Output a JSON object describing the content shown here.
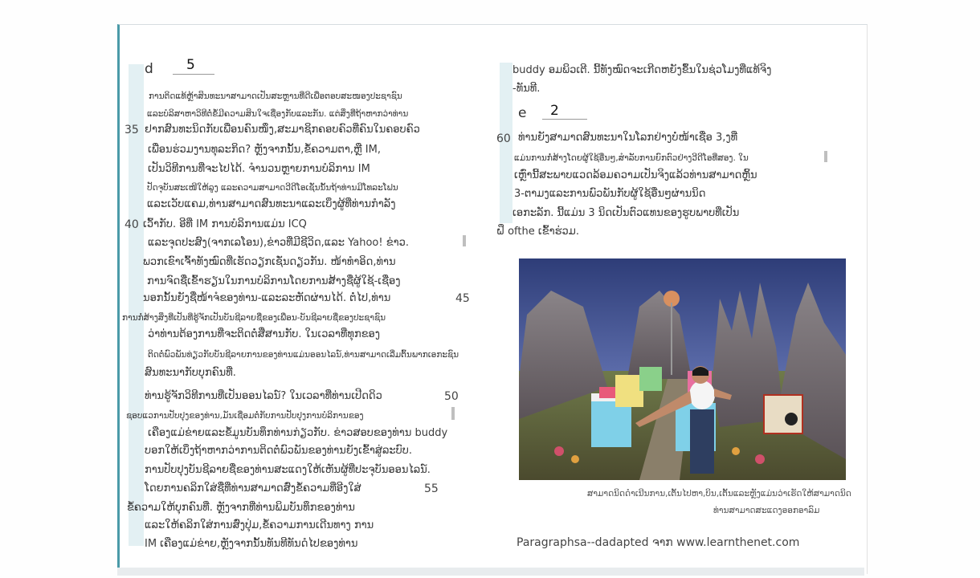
{
  "left": {
    "header_letter": "d",
    "header_number": "5",
    "line_numbers": [
      "35",
      "40",
      "45",
      "50",
      "55"
    ],
    "lines": [
      "ການຕິດແທ້ຫຼ້າສິນທະນາສາມາດເປັນສະຫຼານທີ່ດີເພື່ອຕອບສະໜອງປະຊາຊົນ",
      "ແລະບໍລິສາຫາວິທີຕໍ່ຂໍ້ມີຄວາມສິນໃຈເຊື່ອງກັບແລະກັນ. ແຕ່ສິ່ງທີ່ຖ້າຫາກວ່າທ່ານ",
      "ຢາກສົນທະນິດກັບເພື່ອນຄົນໜຶ່ງ,ສະມາຊິກຄອບຄົວທີ່ຄົນໃນຄອບຄົວ",
      "ເພື່ອນຮ່ວມງານທຸລະກິດ? ຫຼັງຈາກນັ້ນ,ຂໍ້ຄວາມຕາ,ຫຼື IM,",
      "ເປັນວິທີການທີ່ຈະໄປໄດ້. ຈຳນວນຫຼາຍການບໍລິການ IM",
      "ປັດຈຸບັນສະເໜີໃຫ້ລູງ ແລະຄວາມສາມາດວີດີໂອເຊັ່ນນັ້ນຖ້າທ່ານມີໂທລະໂຟນ",
      "ແລະເວັບແຄມ,ທ່ານສາມາດສົນທະນາແລະເບິ່ງຜູ້ທີ່ທ່ານກຳລັງ",
      "ເວົ້າກັບ. ອີທີ່ IM ການບໍລິການແມ່ນ ICQ",
      "ແລະຈຸດປະສົງ(ຈາກເລໂອນ),ຂ່າວທີ່ມີຊີວິດ,ແລະ Yahoo! ຂ່າວ.",
      "ພວກເຂົາເຈົ້າທັງໝົດທີ່ເຮັດວຽກເຊັ່ນດຽວກັນ. ໜ້າທຳອິດ,ທ່ານ",
      "ການຈົດຊື່ເຂົ້າຮຽນໃນການບໍລິການໂດຍການສ້າງຊື່ຜູ້ໃຊ້-ເຊື່ອງ",
      "ນອກນັ້ນຍັງຊື່ໜ້າຈໍຂອງທ່ານ-ແລະລະຫັດຜ່ານໄດ້. ຕໍ່ໄປ,ທ່ານ",
      "ການກໍ່ສ້າງສິ່ງທີ່ເປັນທີ່ຮູ້ຈັກເປັນບັນຊີລາຍຊື່ຂອງເພື່ອນ-ບັນຊີລາຍຊື່ຂອງປະຊາຊົນ",
      "ວ່າທ່ານຕ້ອງການທີ່ຈະຕິດຕໍ່ສື່ສານກັບ. ໃນເວລາທີ່ທຸກຂອງ",
      "ຕິດຕໍ່ພົວພັນທ່ຽວກັບບັນຊີລາຍການຂອງທ່ານແມ່ນອອນໄລນ໌,ທ່ານສາມາດເລີ່ມຕົ້ນພາກເອກະຊົນ",
      "ສົນທະນາກັບບຸກຄົນທີ່.",
      "ທ່ານຮູ້ຈັກວິທີການທີ່ເປັນອອນໄລນ໌? ໃນເວລາທີ່ທ່ານເປີດດິວ",
      "ຊອບແວການປັບປຸງຂອງທ່ານ,ມັນເຊື່ອມຕໍ່ກັບການປັບປຸງການບໍລິການຂອງ",
      "ເຄືອງແມ່ຂ່າຍແລະຂໍ້ມູນບັນທຶກທ່ານກ່ຽວກັບ. ຂ່າວສອບຂອງທ່ານ buddy",
      "ບອກໃຫ້ເບິ່ງຖ້າຫາກວ່າການຕິດຕໍ່ພົວພັນຂອງທ່ານຍັງເຂົ້າສູ່ລະບົບ.",
      "ການປັບປຸງບັນຊີລາຍຊື່ຂອງທ່ານສະແດງໃຫ້ເຫັນຜູ້ທີ່ປະຈຸບັນອອນໄລນ໌.",
      "ໂດຍການຄລິກໃສ່ຊື່ທີ່ທ່ານສາມາດສົ່ງຂໍ້ຄວາມທີ່ອີງໃສ່",
      "ຂໍ້ຄວາມໃຫ້ບຸກຄົນທີ່. ຫຼັງຈາກທີ່ທ່ານພິມບັນທຶກຂອງທ່ານ",
      "ແລະໃຫ້ຄລິກໃສ່ການສົ່ງປຸ່ມ,ຂໍ້ຄວາມການເດີນທາງ ການ",
      "IM ເຄືອງແມ່ຂ່າຍ,ຫຼັງຈາກນັ້ນທັນທີທັນດໍໄປຂອງທ່ານ"
    ]
  },
  "right": {
    "top_lines": [
      "buddy ອມພິວເຕີ. ນີ້ທັງໝົດຈະເກີດຫຍັງຂຶ້ນໃນຊ່ວໂມງທີ່ແທ້ຈິງ",
      "-ທັນທີ."
    ],
    "header_letter": "e",
    "header_number": "2",
    "line_number": "60",
    "lines": [
      "ທ່ານຍັງສາມາດສົນທະນາໃນໂລກຢ່າງບໍ່ໜ້າເຊື່ອ 3,ງທີ່",
      "ແມ່ນການກໍ່ສ້າງໂດຍຜູ້ໃຊ້ອື່ນໆ,ສຳລັບການຍົກຕົວຢ່າງວີດີໂອທີ່ສອງ. ໃນ",
      "ເຫຼົ່ານີ້ສະພາບແວດລ້ອມຄວາມເປັນຈິງແລ້ວທ່ານສາມາດຫຼິ້ນ",
      "3-ຕາມງແລະການພົວພັນກັບຜູ້ໃຊ້ອື່ນໆຜ່ານນິດ",
      "ເອກະລັກ. ນີ້ແມ່ນ 3 ນິດເປັນຕົວແທນຂອງຮູບພາບທີ່ເປັນ",
      "ຝຶ ofthe ເຂົ້າຮ່ວມ."
    ],
    "caption_lines": [
      "ສາມາດນິດດຳເນີນການ,ເຕັ້ນໄປຫາ,ບິນ,ເຕັ້ນແລະຫຼັງແມ່ນວ່າເຮັດໃຫ້ສາມາດນິດ",
      "ທ່ານສາມາດສະແດງອອກອາລົມ"
    ],
    "source": "Paragraphsa--dadapted ຈາກ www.learnthenet.com"
  },
  "colors": {
    "page_border": "#4a9aa8",
    "highlight": "#e3f0f3",
    "text": "#3b3b3b"
  }
}
